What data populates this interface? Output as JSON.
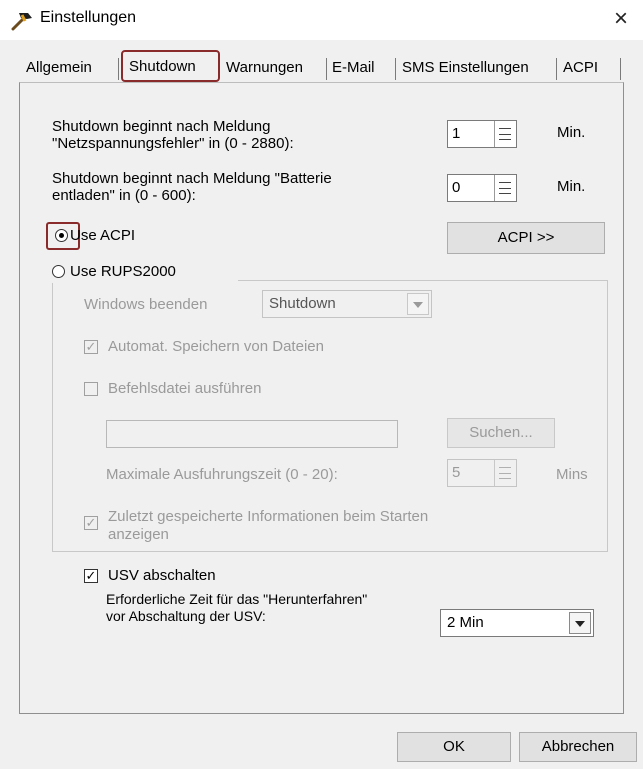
{
  "window": {
    "title": "Einstellungen",
    "close_glyph": "×",
    "app_icon": "hammer-icon"
  },
  "tabs": [
    {
      "label": "Allgemein",
      "active": false
    },
    {
      "label": "Shutdown",
      "active": true
    },
    {
      "label": "Warnungen",
      "active": false
    },
    {
      "label": "E-Mail",
      "active": false
    },
    {
      "label": "SMS Einstellungen",
      "active": false
    },
    {
      "label": "ACPI",
      "active": false
    }
  ],
  "shutdown": {
    "netz_label_line1": "Shutdown beginnt nach Meldung",
    "netz_label_line2": "\"Netzspannungsfehler\" in (0 - 2880):",
    "netz_value": "1",
    "netz_unit": "Min.",
    "batt_label_line1": "Shutdown beginnt nach Meldung \"Batterie",
    "batt_label_line2": "entladen\" in (0 - 600):",
    "batt_value": "0",
    "batt_unit": "Min.",
    "use_acpi_label": "Use ACPI",
    "use_acpi_selected": true,
    "acpi_button": "ACPI >>",
    "use_rups_label": "Use RUPS2000",
    "use_rups_selected": false
  },
  "rups_group": {
    "windows_beenden_label": "Windows beenden",
    "windows_beenden_value": "Shutdown",
    "autosave_label": "Automat. Speichern von Dateien",
    "autosave_checked": true,
    "befehl_label": "Befehlsdatei ausführen",
    "befehl_checked": false,
    "befehl_path": "",
    "suchen_button": "Suchen...",
    "max_zeit_label": "Maximale Ausfuhrungszeit (0 - 20):",
    "max_zeit_value": "5",
    "max_zeit_unit": "Mins",
    "zuletzt_line1": "Zuletzt gespeicherte Informationen beim Starten",
    "zuletzt_line2": "anzeigen",
    "zuletzt_checked": true
  },
  "usv": {
    "abschalten_label": "USV abschalten",
    "abschalten_checked": true,
    "zeit_line1": "Erforderliche Zeit für das \"Herunterfahren\"",
    "zeit_line2": "vor Abschaltung der USV:",
    "zeit_value": "2 Min"
  },
  "footer": {
    "ok": "OK",
    "cancel": "Abbrechen"
  },
  "colors": {
    "highlight": "#8a2b2b",
    "background": "#f0f0f0"
  }
}
